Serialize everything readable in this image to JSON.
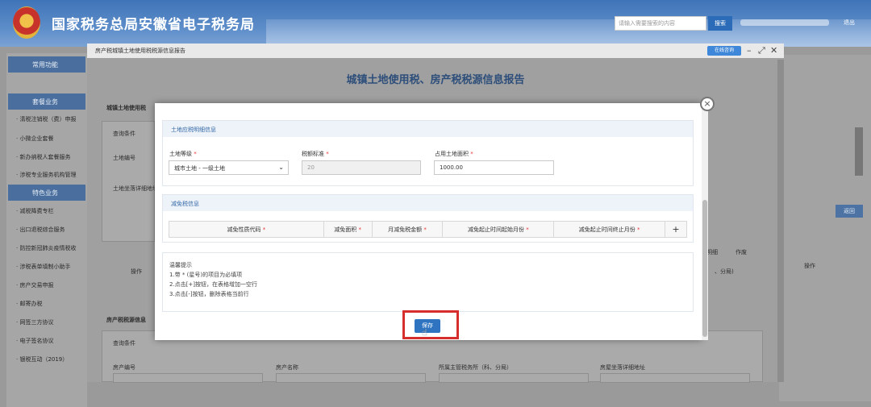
{
  "header": {
    "site_title": "国家税务总局安徽省电子税务局",
    "search_placeholder": "请输入需要搜索的内容",
    "search_button": "搜索",
    "logout": "退出"
  },
  "sidebar": {
    "common_functions": "常用功能",
    "tax_business": "套餐业务",
    "tax_items": [
      "· 清税注销税（费）申报",
      "· 小微企业套餐",
      "· 新办纳税人套餐服务",
      "· 涉税专业服务机构管理"
    ],
    "special_business": "特色业务",
    "special_items": [
      "· 减税降费专栏",
      "· 出口退税综合服务",
      "· 防控新冠肺炎疫情税收",
      "· 涉税表单填制小助手",
      "· 房产交易申报",
      "· 邮寄办税",
      "· 网签三方协议",
      "· 电子签名协议",
      "· 银税互动（2019）"
    ]
  },
  "background_page": {
    "back_button": "返回",
    "operation_header": "操作"
  },
  "outer_dialog": {
    "titlebar": "房产税城镇土地使用税税源信息报告",
    "consult_button": "在线咨询",
    "heading": "城镇土地使用税、房产税税源信息报告",
    "land_section": "城镇土地使用税",
    "query_conditions": "查询条件",
    "land_number": "土地编号",
    "land_address": "土地坐落详细地址",
    "operation": "操作",
    "property_section": "房产税税源信息",
    "property_query": "查询条件",
    "property_number": "房产编号",
    "property_name": "房产名称",
    "tax_authority": "所属主管税务所（科、分局）",
    "property_address": "房屋坐落详细地址",
    "action_modify": "明细",
    "action_void": "作废",
    "bureau_suffix": "、分局)"
  },
  "modal": {
    "land_tax_section": "土地应税明细信息",
    "land_grade_label": "土地等级",
    "land_grade_value": "城市土地 - 一级土地",
    "tax_standard_label": "税额标准",
    "tax_standard_value": "20",
    "occupied_area_label": "占用土地面积",
    "occupied_area_value": "1000.00",
    "relief_section": "减免税信息",
    "relief_columns": [
      "减免性质代码",
      "减免面积",
      "月减免税金额",
      "减免起止时间起始月份",
      "减免起止时间终止月份"
    ],
    "add_symbol": "+",
    "tips_title": "温馨提示",
    "tips": [
      "1.带 * (星号)的项目为必填项",
      "2.点击[+]按钮，在表格增加一空行",
      "3.点击[-]按钮，删除表格当前行"
    ],
    "save_button": "保存",
    "required_mark": "*"
  },
  "colors": {
    "accent": "#2f74c0",
    "highlight": "#d62d2d",
    "section_head_text": "#3569a8"
  }
}
